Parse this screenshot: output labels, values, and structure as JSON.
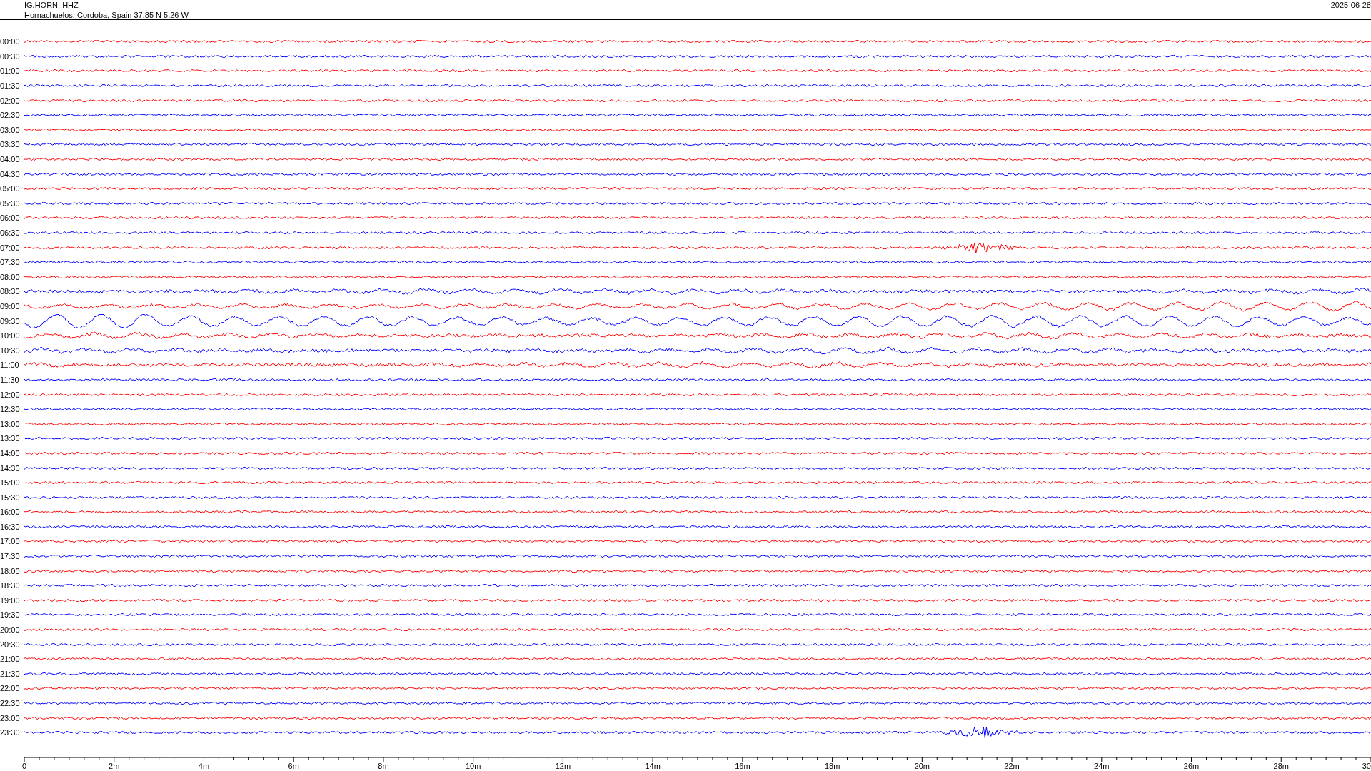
{
  "header": {
    "station": "IG.HORN..HHZ",
    "location": "Hornachuelos, Cordoba, Spain  37.85 N 5.26 W",
    "date": "2025-06-28"
  },
  "rows": [
    {
      "label": "00:00",
      "color": "#ff0000",
      "kind": "quiet"
    },
    {
      "label": "00:30",
      "color": "#0000ff",
      "kind": "quiet"
    },
    {
      "label": "01:00",
      "color": "#ff0000",
      "kind": "quiet"
    },
    {
      "label": "01:30",
      "color": "#0000ff",
      "kind": "quiet"
    },
    {
      "label": "02:00",
      "color": "#ff0000",
      "kind": "quiet"
    },
    {
      "label": "02:30",
      "color": "#0000ff",
      "kind": "quiet"
    },
    {
      "label": "03:00",
      "color": "#ff0000",
      "kind": "quiet"
    },
    {
      "label": "03:30",
      "color": "#0000ff",
      "kind": "quiet"
    },
    {
      "label": "04:00",
      "color": "#ff0000",
      "kind": "quiet"
    },
    {
      "label": "04:30",
      "color": "#0000ff",
      "kind": "quiet"
    },
    {
      "label": "05:00",
      "color": "#ff0000",
      "kind": "quiet"
    },
    {
      "label": "05:30",
      "color": "#0000ff",
      "kind": "quiet"
    },
    {
      "label": "06:00",
      "color": "#ff0000",
      "kind": "quiet"
    },
    {
      "label": "06:30",
      "color": "#0000ff",
      "kind": "quiet"
    },
    {
      "label": "07:00",
      "color": "#ff0000",
      "kind": "burst"
    },
    {
      "label": "07:30",
      "color": "#0000ff",
      "kind": "quiet"
    },
    {
      "label": "08:00",
      "color": "#ff0000",
      "kind": "quiet"
    },
    {
      "label": "08:30",
      "color": "#0000ff",
      "kind": "active"
    },
    {
      "label": "09:00",
      "color": "#ff0000",
      "kind": "swell"
    },
    {
      "label": "09:30",
      "color": "#0000ff",
      "kind": "swell"
    },
    {
      "label": "10:00",
      "color": "#ff0000",
      "kind": "active"
    },
    {
      "label": "10:30",
      "color": "#0000ff",
      "kind": "active"
    },
    {
      "label": "11:00",
      "color": "#ff0000",
      "kind": "active"
    },
    {
      "label": "11:30",
      "color": "#0000ff",
      "kind": "quiet"
    },
    {
      "label": "12:00",
      "color": "#ff0000",
      "kind": "quiet"
    },
    {
      "label": "12:30",
      "color": "#0000ff",
      "kind": "quiet"
    },
    {
      "label": "13:00",
      "color": "#ff0000",
      "kind": "quiet"
    },
    {
      "label": "13:30",
      "color": "#0000ff",
      "kind": "quiet"
    },
    {
      "label": "14:00",
      "color": "#ff0000",
      "kind": "quiet"
    },
    {
      "label": "14:30",
      "color": "#0000ff",
      "kind": "quiet"
    },
    {
      "label": "15:00",
      "color": "#ff0000",
      "kind": "quiet"
    },
    {
      "label": "15:30",
      "color": "#0000ff",
      "kind": "quiet"
    },
    {
      "label": "16:00",
      "color": "#ff0000",
      "kind": "quiet"
    },
    {
      "label": "16:30",
      "color": "#0000ff",
      "kind": "quiet"
    },
    {
      "label": "17:00",
      "color": "#ff0000",
      "kind": "quiet"
    },
    {
      "label": "17:30",
      "color": "#0000ff",
      "kind": "quiet"
    },
    {
      "label": "18:00",
      "color": "#ff0000",
      "kind": "quiet"
    },
    {
      "label": "18:30",
      "color": "#0000ff",
      "kind": "quiet"
    },
    {
      "label": "19:00",
      "color": "#ff0000",
      "kind": "quiet"
    },
    {
      "label": "19:30",
      "color": "#0000ff",
      "kind": "quiet"
    },
    {
      "label": "20:00",
      "color": "#ff0000",
      "kind": "quiet"
    },
    {
      "label": "20:30",
      "color": "#0000ff",
      "kind": "quiet"
    },
    {
      "label": "21:00",
      "color": "#ff0000",
      "kind": "quiet"
    },
    {
      "label": "21:30",
      "color": "#0000ff",
      "kind": "quiet"
    },
    {
      "label": "22:00",
      "color": "#ff0000",
      "kind": "quiet"
    },
    {
      "label": "22:30",
      "color": "#0000ff",
      "kind": "quiet"
    },
    {
      "label": "23:00",
      "color": "#ff0000",
      "kind": "quiet"
    },
    {
      "label": "23:30",
      "color": "#0000ff",
      "kind": "burst"
    }
  ],
  "time_axis": {
    "ticks": [
      "0",
      "2m",
      "4m",
      "6m",
      "8m",
      "10m",
      "12m",
      "14m",
      "16m",
      "18m",
      "20m",
      "22m",
      "24m",
      "26m",
      "28m",
      "30"
    ]
  }
}
